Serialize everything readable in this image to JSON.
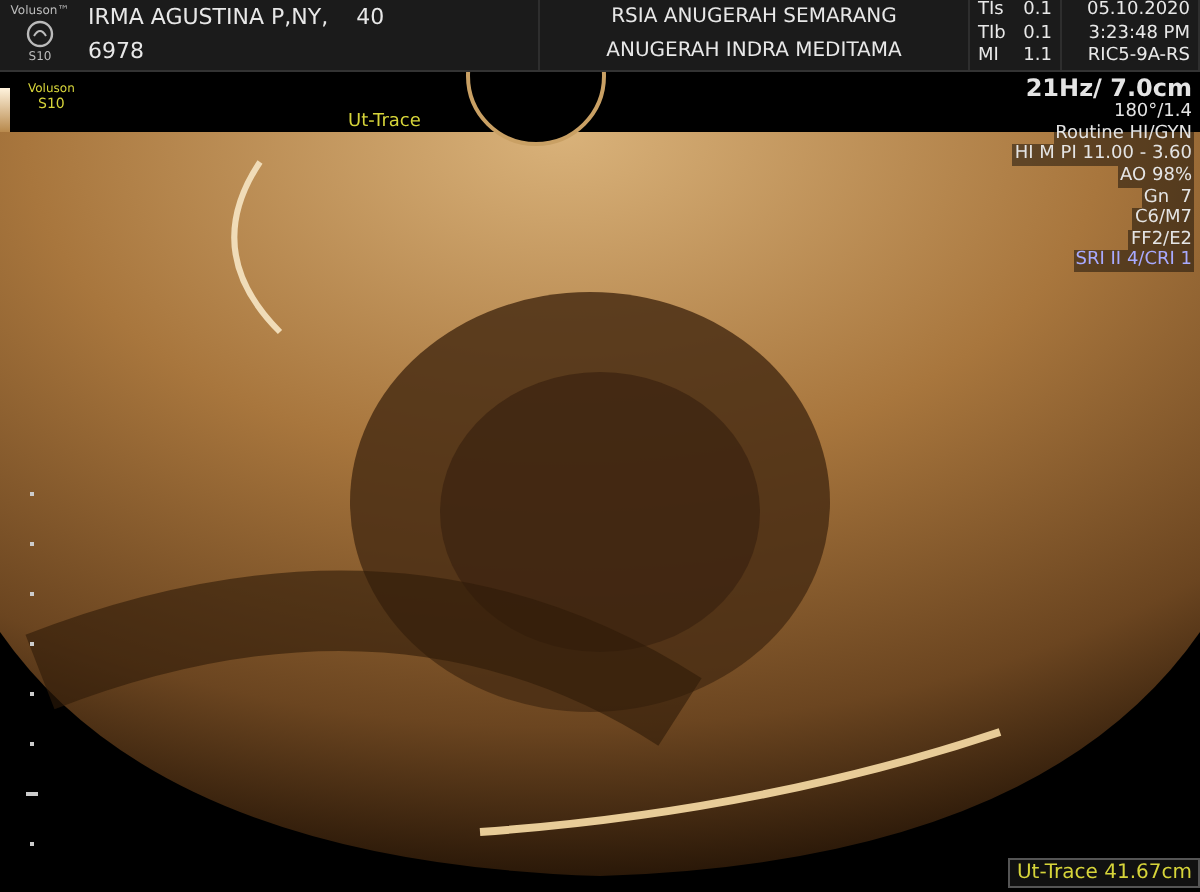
{
  "header": {
    "brand": "Voluson™",
    "model": "S10",
    "patient_name": "IRMA AGUSTINA P,NY,",
    "patient_age": "40",
    "patient_id": "6978",
    "hospital": "RSIA ANUGERAH SEMARANG",
    "operator": "ANUGERAH INDRA MEDITAMA",
    "indices": [
      {
        "label": "TIs",
        "value": "0.1"
      },
      {
        "label": "TIb",
        "value": "0.1"
      },
      {
        "label": "MI",
        "value": "1.1"
      }
    ],
    "date": "05.10.2020",
    "time": "3:23:48 PM",
    "probe": "RIC5-9A-RS"
  },
  "grayscale_bar": {
    "brand": "Voluson",
    "model": "S10"
  },
  "image": {
    "trace_label": "Ut-Trace"
  },
  "parameters": [
    {
      "text": "21Hz/ 7.0cm",
      "kind": "heading"
    },
    {
      "text": "180°/1.4",
      "kind": "plain"
    },
    {
      "text": "Routine HI/GYN",
      "kind": "plain"
    },
    {
      "text": "HI M PI 11.00 - 3.60",
      "kind": "plain"
    },
    {
      "text": "AO 98%",
      "kind": "plain"
    },
    {
      "text": "Gn  7",
      "kind": "plain"
    },
    {
      "text": "C6/M7",
      "kind": "plain"
    },
    {
      "text": "FF2/E2",
      "kind": "plain"
    },
    {
      "text": "SRI II 4/CRI 1",
      "kind": "highlight"
    }
  ],
  "measurement": {
    "text": "Ut-Trace 41.67cm"
  }
}
